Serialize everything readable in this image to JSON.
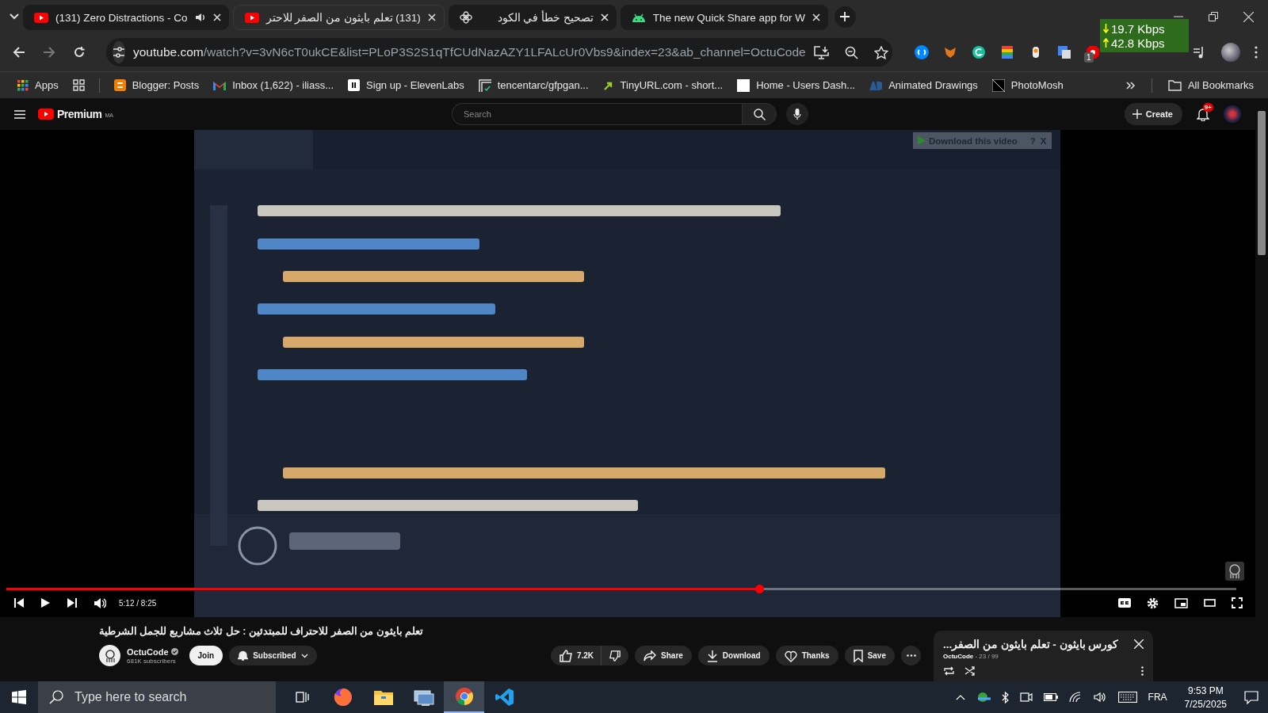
{
  "browser": {
    "tabs": [
      {
        "title": "(131) Zero Distractions - Co",
        "kind": "video",
        "selected": false,
        "playing_audio": true
      },
      {
        "title": "(131) تعلم بايثون من الصفر للاحتر",
        "kind": "video",
        "selected": true,
        "playing_audio": false
      },
      {
        "title": "تصحيح خطأ في الكود",
        "kind": "chat",
        "selected": false,
        "playing_audio": false
      },
      {
        "title": "The new Quick Share app for W",
        "kind": "android",
        "selected": false,
        "playing_audio": false
      }
    ],
    "address": {
      "host": "youtube.com",
      "path": "/watch?v=3vN6cT0ukCE&list=PLoP3S2S1qTfCUdNazAZY1LFALcUr0Vbs9&index=23&ab_channel=OctuCode"
    },
    "extension_badge": "1",
    "net_meter": {
      "download": "19.7 Kbps",
      "upload": "42.8 Kbps"
    },
    "bookmarks": [
      {
        "label": "Apps",
        "kind": "apps"
      },
      {
        "label": "Blogger: Posts",
        "kind": "blogger"
      },
      {
        "label": "Inbox (1,622) - iliass...",
        "kind": "mail"
      },
      {
        "label": "Sign up - ElevenLabs",
        "kind": "pause"
      },
      {
        "label": "tencentarc/gfpgan...",
        "kind": "frame"
      },
      {
        "label": "TinyURL.com - short...",
        "kind": "arrow"
      },
      {
        "label": "Home - Users Dash...",
        "kind": "blank"
      },
      {
        "label": "Animated Drawings",
        "kind": "letters"
      },
      {
        "label": "PhotoMosh",
        "kind": "diagonal"
      }
    ],
    "all_bookmarks": "All Bookmarks"
  },
  "youtube": {
    "logo": "Premium",
    "region": "MA",
    "search": {
      "placeholder": "Search"
    },
    "create": "Create",
    "notifications": "9+",
    "player": {
      "overlay": {
        "label": "Download this video",
        "help": "?",
        "close": "X"
      },
      "progress": {
        "level": 0.612
      },
      "time": "5:12 / 8:25"
    },
    "video": {
      "title": "تعلم بايثون من الصفر للاحتراف للمبتدئين : حل ثلاث مشاريع للجمل الشرطية",
      "channel": "OctuCode",
      "verified": true,
      "subscribers": "681K subscribers",
      "join": "Join",
      "subscribe": "Subscribed",
      "actions": [
        {
          "label": "7.2K",
          "kind": "like"
        },
        {
          "label": "Share",
          "kind": "share"
        },
        {
          "label": "Download",
          "kind": "download"
        },
        {
          "label": "Thanks",
          "kind": "thanks"
        },
        {
          "label": "Save",
          "kind": "save"
        }
      ]
    },
    "playlist": {
      "title": "كورس بايثون - تعلم بايثون من الصفر...",
      "byline": "**OctuCode** - 23 / 99"
    }
  },
  "taskbar": {
    "search": {
      "placeholder": "Type here to search"
    },
    "apps": [
      {
        "kind": "taskview",
        "selected": false
      },
      {
        "kind": "fox",
        "selected": false
      },
      {
        "kind": "folder",
        "selected": false
      },
      {
        "kind": "monitor",
        "selected": false
      },
      {
        "kind": "chrome",
        "selected": true
      },
      {
        "kind": "code",
        "selected": false
      }
    ],
    "language": "FRA",
    "time": "9:53 PM",
    "date": "7/25/2025"
  }
}
